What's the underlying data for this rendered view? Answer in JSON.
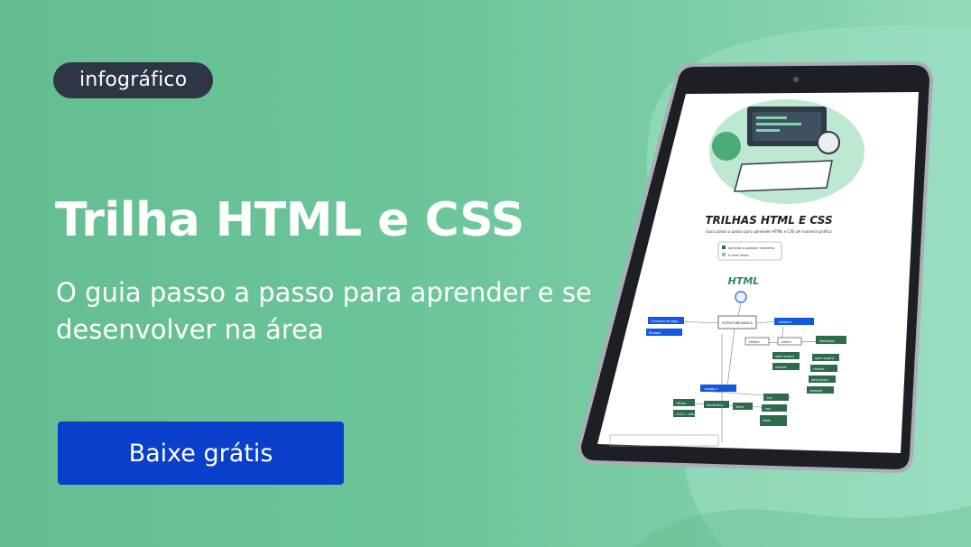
{
  "tag": "infográfico",
  "title": "Trilha HTML e CSS",
  "subtitle": "O guia passo a passo para aprender e se desenvolver na área",
  "cta": "Baixe grátis",
  "colors": {
    "background_start": "#64be91",
    "background_end": "#94dbbc",
    "tag_bg": "#2e3544",
    "cta_bg": "#0a3fcb",
    "text": "#ffffff"
  },
  "tablet": {
    "doc_title": "TRILHAS HTML E CSS",
    "doc_subtitle": "Guia passo a passo para aprender HTML e CSS de maneira gráfica",
    "legend": [
      "Aprenda a qualquer momento",
      "A fazer ainda"
    ],
    "section": "HTML",
    "root_node": "ESTRUTURA BÁSICA",
    "left_nodes": [
      "Conceito de tags",
      "Sintaxe"
    ],
    "head_node": "<head>",
    "head_children": [
      "<title>",
      "<link>",
      "Metatags"
    ],
    "meta_children": [
      "open graphs",
      "charset",
      "description",
      "viewport"
    ],
    "link_children": [
      "open graphs",
      "charset"
    ],
    "body_node": "<body>",
    "body_children": [
      "Títulos",
      "Semântica",
      "Texto"
    ],
    "titles_child": "<h1>...<h6>",
    "text_children": [
      "<p>",
      "<a>",
      "listas"
    ]
  }
}
